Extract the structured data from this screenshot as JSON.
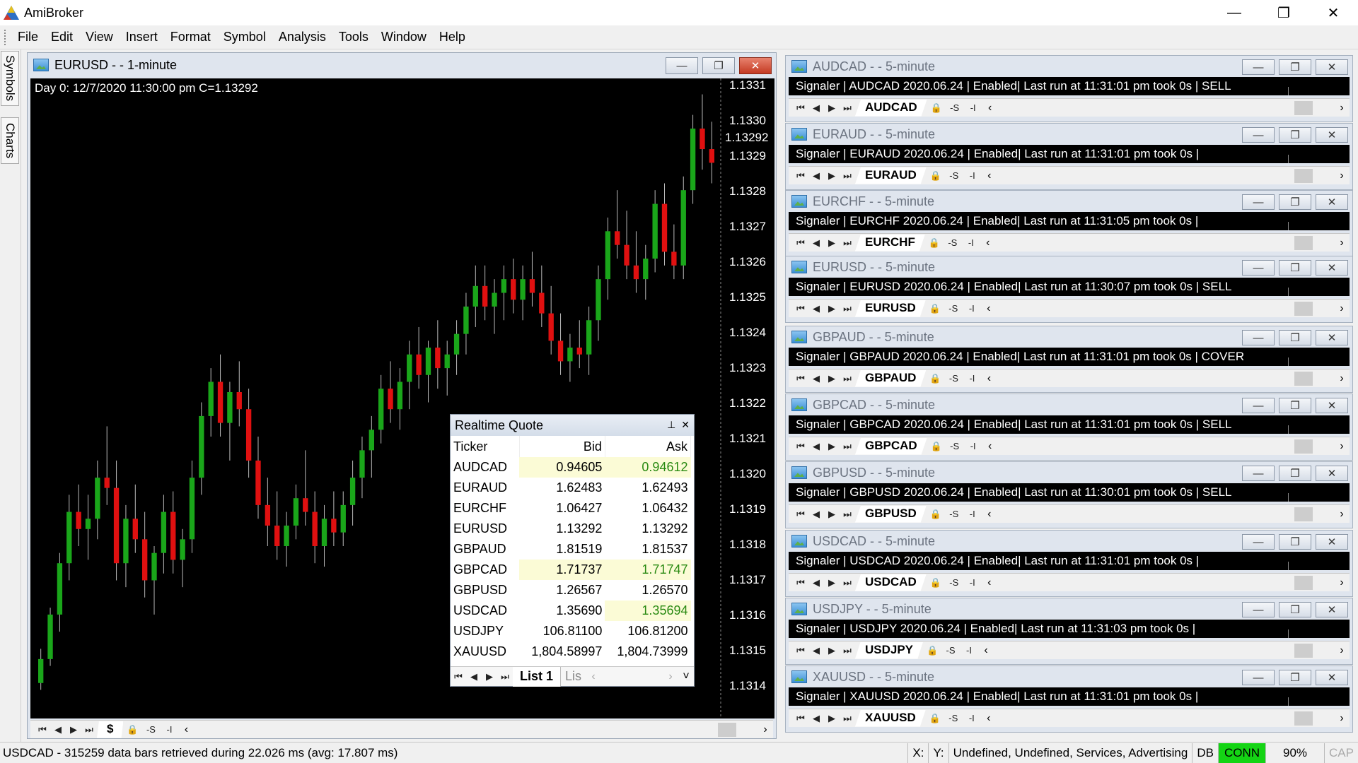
{
  "app": {
    "title": "AmiBroker",
    "window_controls": {
      "minimize": "—",
      "maximize": "❐",
      "close": "✕"
    }
  },
  "menu": [
    "File",
    "Edit",
    "View",
    "Insert",
    "Format",
    "Symbol",
    "Analysis",
    "Tools",
    "Window",
    "Help"
  ],
  "side_tabs": [
    "Symbols",
    "Charts"
  ],
  "main_chart": {
    "title": "EURUSD -  - 1-minute",
    "info": "Day 0: 12/7/2020 11:30:00 pm C=1.13292",
    "last_price": "1.13292",
    "symbol_tab": "$",
    "y_labels": [
      "1.1331",
      "1.1330",
      "1.1329",
      "1.1328",
      "1.1327",
      "1.1326",
      "1.1325",
      "1.1324",
      "1.1323",
      "1.1322",
      "1.1321",
      "1.1320",
      "1.1319",
      "1.1318",
      "1.1317",
      "1.1316",
      "1.1315",
      "1.1314"
    ],
    "colors": {
      "up": "#1aa61a",
      "down": "#e01010",
      "wick": "#bbbbbb"
    }
  },
  "chart_data": {
    "type": "candlestick",
    "ylim": [
      1.13135,
      1.13315
    ],
    "ohlc": [
      [
        1.1314,
        1.1315,
        1.13138,
        1.13147
      ],
      [
        1.13147,
        1.13162,
        1.13145,
        1.1316
      ],
      [
        1.1316,
        1.13178,
        1.13155,
        1.13175
      ],
      [
        1.13175,
        1.13195,
        1.1317,
        1.1319
      ],
      [
        1.1319,
        1.13198,
        1.1318,
        1.13185
      ],
      [
        1.13185,
        1.13195,
        1.13176,
        1.13188
      ],
      [
        1.13188,
        1.13205,
        1.13182,
        1.132
      ],
      [
        1.132,
        1.13215,
        1.13192,
        1.13197
      ],
      [
        1.13197,
        1.13205,
        1.1317,
        1.13175
      ],
      [
        1.13175,
        1.13192,
        1.13168,
        1.13188
      ],
      [
        1.13188,
        1.13198,
        1.13178,
        1.13182
      ],
      [
        1.13182,
        1.1319,
        1.13165,
        1.1317
      ],
      [
        1.1317,
        1.1318,
        1.1316,
        1.13178
      ],
      [
        1.13178,
        1.13195,
        1.13172,
        1.1319
      ],
      [
        1.1319,
        1.13196,
        1.13172,
        1.13176
      ],
      [
        1.13176,
        1.13185,
        1.13168,
        1.13182
      ],
      [
        1.13182,
        1.13205,
        1.13178,
        1.132
      ],
      [
        1.132,
        1.13222,
        1.13195,
        1.13218
      ],
      [
        1.13218,
        1.13232,
        1.13212,
        1.13228
      ],
      [
        1.13228,
        1.13236,
        1.13212,
        1.13216
      ],
      [
        1.13216,
        1.13228,
        1.13205,
        1.13225
      ],
      [
        1.13225,
        1.13234,
        1.13215,
        1.1322
      ],
      [
        1.1322,
        1.13226,
        1.132,
        1.13205
      ],
      [
        1.13205,
        1.13212,
        1.13188,
        1.13192
      ],
      [
        1.13192,
        1.132,
        1.1318,
        1.13186
      ],
      [
        1.13186,
        1.13196,
        1.13176,
        1.1318
      ],
      [
        1.1318,
        1.1319,
        1.13174,
        1.13186
      ],
      [
        1.13186,
        1.13198,
        1.13182,
        1.13194
      ],
      [
        1.13194,
        1.13208,
        1.13186,
        1.1319
      ],
      [
        1.1319,
        1.13196,
        1.13175,
        1.1318
      ],
      [
        1.1318,
        1.13192,
        1.13174,
        1.13188
      ],
      [
        1.13188,
        1.13196,
        1.1318,
        1.13184
      ],
      [
        1.13184,
        1.13196,
        1.1318,
        1.13192
      ],
      [
        1.13192,
        1.13205,
        1.13186,
        1.132
      ],
      [
        1.132,
        1.13212,
        1.13194,
        1.13208
      ],
      [
        1.13208,
        1.13218,
        1.132,
        1.13214
      ],
      [
        1.13214,
        1.1323,
        1.1321,
        1.13226
      ],
      [
        1.13226,
        1.13234,
        1.13216,
        1.1322
      ],
      [
        1.1322,
        1.13232,
        1.13214,
        1.13228
      ],
      [
        1.13228,
        1.1324,
        1.1322,
        1.13236
      ],
      [
        1.13236,
        1.13244,
        1.13226,
        1.1323
      ],
      [
        1.1323,
        1.1324,
        1.13222,
        1.13238
      ],
      [
        1.13238,
        1.13246,
        1.13226,
        1.13232
      ],
      [
        1.13232,
        1.1324,
        1.13224,
        1.13236
      ],
      [
        1.13236,
        1.13246,
        1.1323,
        1.13242
      ],
      [
        1.13242,
        1.13254,
        1.13236,
        1.1325
      ],
      [
        1.1325,
        1.13262,
        1.13244,
        1.13256
      ],
      [
        1.13256,
        1.13262,
        1.13246,
        1.1325
      ],
      [
        1.1325,
        1.13258,
        1.13242,
        1.13254
      ],
      [
        1.13254,
        1.13262,
        1.13246,
        1.13258
      ],
      [
        1.13258,
        1.13264,
        1.13248,
        1.13252
      ],
      [
        1.13252,
        1.13262,
        1.13246,
        1.13258
      ],
      [
        1.13258,
        1.13266,
        1.1325,
        1.13254
      ],
      [
        1.13254,
        1.13262,
        1.13244,
        1.13248
      ],
      [
        1.13248,
        1.13256,
        1.13236,
        1.1324
      ],
      [
        1.1324,
        1.13248,
        1.1323,
        1.13234
      ],
      [
        1.13234,
        1.13242,
        1.13228,
        1.13238
      ],
      [
        1.13238,
        1.13246,
        1.13232,
        1.13236
      ],
      [
        1.13236,
        1.1325,
        1.1323,
        1.13246
      ],
      [
        1.13246,
        1.13262,
        1.1324,
        1.13258
      ],
      [
        1.13258,
        1.13276,
        1.13252,
        1.13272
      ],
      [
        1.13272,
        1.13284,
        1.13264,
        1.13268
      ],
      [
        1.13268,
        1.13278,
        1.13258,
        1.13262
      ],
      [
        1.13262,
        1.13272,
        1.13254,
        1.13258
      ],
      [
        1.13258,
        1.13268,
        1.13252,
        1.13264
      ],
      [
        1.13264,
        1.13284,
        1.1326,
        1.1328
      ],
      [
        1.1328,
        1.13286,
        1.13262,
        1.13266
      ],
      [
        1.13266,
        1.13274,
        1.13258,
        1.13262
      ],
      [
        1.13262,
        1.13288,
        1.13258,
        1.13284
      ],
      [
        1.13284,
        1.13306,
        1.1328,
        1.13302
      ],
      [
        1.13302,
        1.13312,
        1.1329,
        1.13296
      ],
      [
        1.13296,
        1.13304,
        1.13286,
        1.13292
      ]
    ]
  },
  "realtime_quote": {
    "title": "Realtime Quote",
    "pin": "⊥",
    "close": "✕",
    "columns": [
      "Ticker",
      "Bid",
      "Ask"
    ],
    "rows": [
      {
        "ticker": "AUDCAD",
        "bid": "0.94605",
        "ask": "0.94612",
        "bid_hl": true,
        "ask_hl": true
      },
      {
        "ticker": "EURAUD",
        "bid": "1.62483",
        "ask": "1.62493",
        "bid_hl": false,
        "ask_hl": false
      },
      {
        "ticker": "EURCHF",
        "bid": "1.06427",
        "ask": "1.06432",
        "bid_hl": false,
        "ask_hl": false
      },
      {
        "ticker": "EURUSD",
        "bid": "1.13292",
        "ask": "1.13292",
        "bid_hl": false,
        "ask_hl": false
      },
      {
        "ticker": "GBPAUD",
        "bid": "1.81519",
        "ask": "1.81537",
        "bid_hl": false,
        "ask_hl": false
      },
      {
        "ticker": "GBPCAD",
        "bid": "1.71737",
        "ask": "1.71747",
        "bid_hl": true,
        "ask_hl": true
      },
      {
        "ticker": "GBPUSD",
        "bid": "1.26567",
        "ask": "1.26570",
        "bid_hl": false,
        "ask_hl": false
      },
      {
        "ticker": "USDCAD",
        "bid": "1.35690",
        "ask": "1.35694",
        "bid_hl": false,
        "ask_hl": true
      },
      {
        "ticker": "USDJPY",
        "bid": "106.81100",
        "ask": "106.81200",
        "bid_hl": false,
        "ask_hl": false
      },
      {
        "ticker": "XAUUSD",
        "bid": "1,804.58997",
        "ask": "1,804.73999",
        "bid_hl": false,
        "ask_hl": false
      }
    ],
    "tab_active": "List 1",
    "tab_other": "Lis"
  },
  "signal_panes": [
    {
      "title": "AUDCAD -  - 5-minute",
      "signal": "Signaler | AUDCAD 2020.06.24 | Enabled| Last run at 11:31:01 pm took 0s | SELL",
      "symbol": "AUDCAD"
    },
    {
      "title": "EURAUD -  - 5-minute",
      "signal": "Signaler | EURAUD 2020.06.24 | Enabled| Last run at 11:31:01 pm took 0s |",
      "symbol": "EURAUD"
    },
    {
      "title": "EURCHF -  - 5-minute",
      "signal": "Signaler | EURCHF 2020.06.24 | Enabled| Last run at 11:31:05 pm took 0s |",
      "symbol": "EURCHF"
    },
    {
      "title": "EURUSD -  - 5-minute",
      "signal": "Signaler | EURUSD 2020.06.24 | Enabled| Last run at 11:30:07 pm took 0s | SELL",
      "symbol": "EURUSD"
    },
    {
      "title": "GBPAUD -  - 5-minute",
      "signal": "Signaler | GBPAUD 2020.06.24 | Enabled| Last run at 11:31:01 pm took 0s |  COVER",
      "symbol": "GBPAUD"
    },
    {
      "title": "GBPCAD -  - 5-minute",
      "signal": "Signaler | GBPCAD 2020.06.24 | Enabled| Last run at 11:31:01 pm took 0s | SELL",
      "symbol": "GBPCAD"
    },
    {
      "title": "GBPUSD -  - 5-minute",
      "signal": "Signaler | GBPUSD 2020.06.24 | Enabled| Last run at 11:30:01 pm took 0s | SELL",
      "symbol": "GBPUSD"
    },
    {
      "title": "USDCAD -  - 5-minute",
      "signal": "Signaler | USDCAD 2020.06.24 | Enabled| Last run at 11:31:01 pm took 0s |",
      "symbol": "USDCAD"
    },
    {
      "title": "USDJPY -  - 5-minute",
      "signal": "Signaler | USDJPY 2020.06.24 | Enabled| Last run at 11:31:03 pm took 0s |",
      "symbol": "USDJPY"
    },
    {
      "title": "XAUUSD -  - 5-minute",
      "signal": "Signaler | XAUUSD 2020.06.24 | Enabled| Last run at 11:31:01 pm took 0s |",
      "symbol": "XAUUSD"
    }
  ],
  "toolbar": {
    "first": "⏮",
    "prev": "◀",
    "next": "▶",
    "last": "⏭",
    "lock": "🔒",
    "minus_s": "-S",
    "minus_i": "-I",
    "left": "‹",
    "right": "›"
  },
  "status": {
    "message": "USDCAD - 315259 data bars retrieved during 22.026 ms (avg: 17.807 ms)",
    "x": "X:",
    "y": "Y:",
    "category": "Undefined, Undefined, Services, Advertising",
    "db": "DB",
    "conn": "CONN",
    "zoom": "90%",
    "cap": "CAP"
  }
}
